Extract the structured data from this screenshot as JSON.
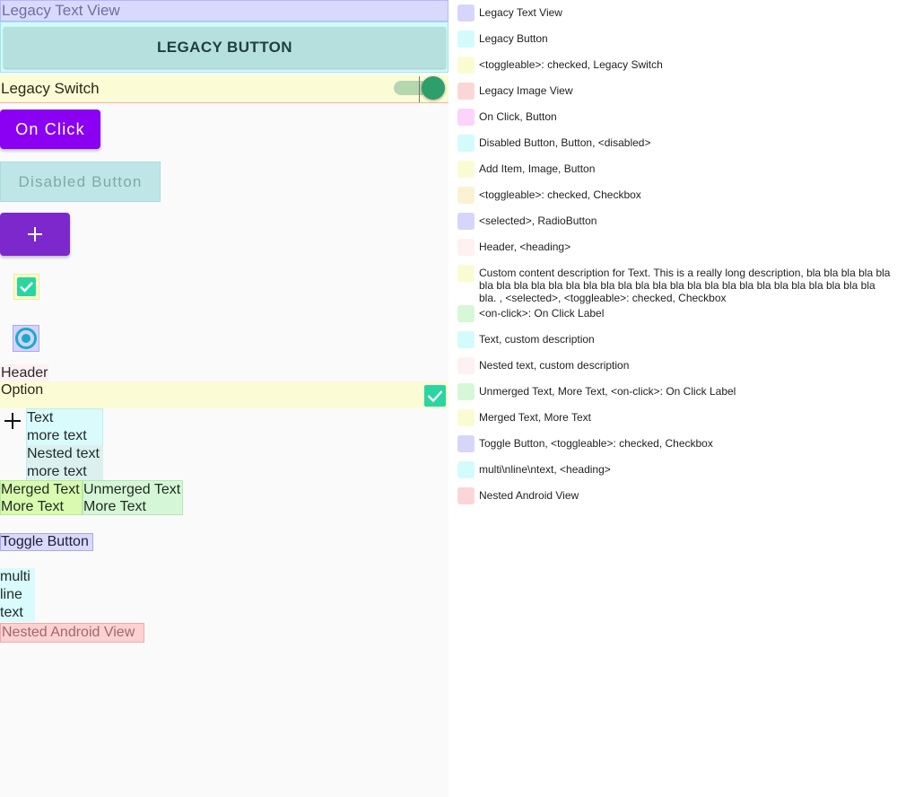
{
  "left_panel": {
    "legacy_text_view": "Legacy Text View",
    "legacy_button": "LEGACY BUTTON",
    "legacy_switch": {
      "label": "Legacy Switch",
      "checked": true
    },
    "on_click_button": "On Click",
    "disabled_button": "Disabled Button",
    "add_item_button": "+",
    "checkbox": {
      "checked": true
    },
    "radio": {
      "selected": true
    },
    "header": "Header",
    "option": {
      "label": "Option",
      "checked": true
    },
    "text_group": {
      "line1": "Text",
      "line2": "more text",
      "nested_line1": "Nested text",
      "nested_line2": "more text"
    },
    "merged": {
      "line1": "Merged Text",
      "line2": "More Text"
    },
    "unmerged": {
      "line1": "Unmerged Text",
      "line2": "More Text"
    },
    "toggle_button": "Toggle Button",
    "multiline": [
      "multi",
      "line",
      "text"
    ],
    "nested_android_view": "Nested Android View"
  },
  "legend": [
    {
      "label": "Legacy Text View",
      "color": "#d6d6fa"
    },
    {
      "label": "Legacy Button",
      "color": "#d3fbfb"
    },
    {
      "label": "<toggleable>: checked, Legacy Switch",
      "color": "#fbfbd3"
    },
    {
      "label": "Legacy Image View",
      "color": "#fbd6d6"
    },
    {
      "label": "On Click, Button",
      "color": "#fbd3fb"
    },
    {
      "label": "Disabled Button, Button, <disabled>",
      "color": "#d3fbfb"
    },
    {
      "label": "Add Item, Image, Button",
      "color": "#fbfbd3"
    },
    {
      "label": "<toggleable>: checked, Checkbox",
      "color": "#fbf1d3"
    },
    {
      "label": "<selected>, RadioButton",
      "color": "#d6d6fa"
    },
    {
      "label": "Header, <heading>",
      "color": "#fdf1f1"
    },
    {
      "label": "Custom content description for Text. This is a really long description, bla bla bla bla bla bla bla bla bla bla bla bla bla bla bla bla bla bla bla bla bla bla bla bla bla bla bla bla bla. , <selected>, <toggleable>: checked, Checkbox",
      "color": "#fbfbd3"
    },
    {
      "label": "<on-click>: On Click Label",
      "color": "#d6f8d6"
    },
    {
      "label": "Text, custom description",
      "color": "#d3fbfb"
    },
    {
      "label": "Nested text, custom description",
      "color": "#fdf1f1"
    },
    {
      "label": "Unmerged Text, More Text, <on-click>: On Click Label",
      "color": "#d6f8d6"
    },
    {
      "label": "Merged Text, More Text",
      "color": "#fbfbd3"
    },
    {
      "label": "Toggle Button, <toggleable>: checked, Checkbox",
      "color": "#d6d6fa"
    },
    {
      "label": "multi\\nline\\ntext, <heading>",
      "color": "#d3fbfb"
    },
    {
      "label": "Nested Android View",
      "color": "#fbd6d6"
    }
  ]
}
